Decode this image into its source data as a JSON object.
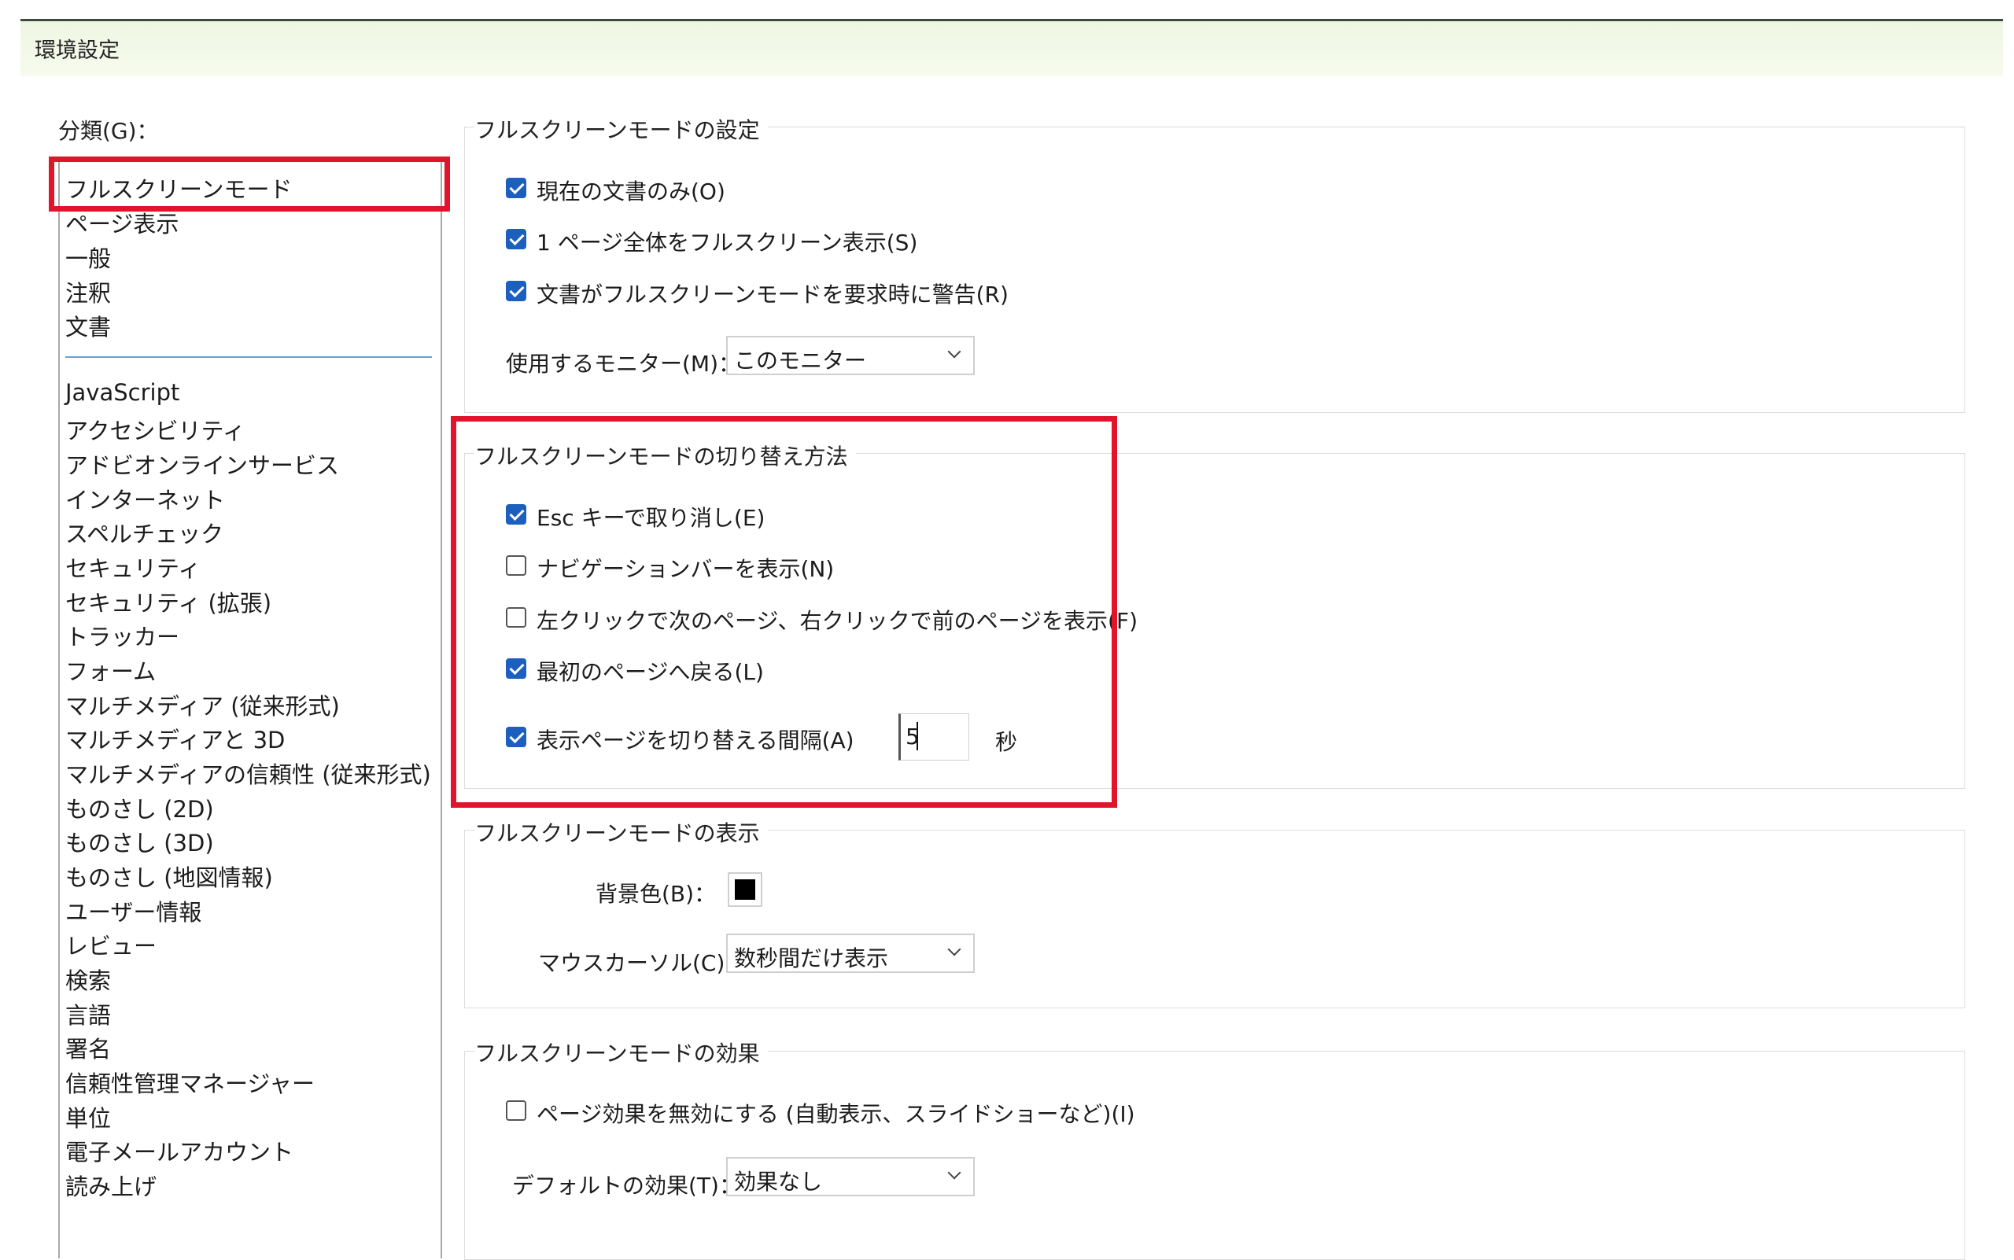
{
  "window": {
    "title": "環境設定"
  },
  "categories": {
    "label": "分類(G)：",
    "primary": [
      "フルスクリーンモード",
      "ページ表示",
      "一般",
      "注釈",
      "文書"
    ],
    "secondary": [
      "JavaScript",
      "アクセシビリティ",
      "アドビオンラインサービス",
      "インターネット",
      "スペルチェック",
      "セキュリティ",
      "セキュリティ (拡張)",
      "トラッカー",
      "フォーム",
      "マルチメディア (従来形式)",
      "マルチメディアと 3D",
      "マルチメディアの信頼性 (従来形式)",
      "ものさし (2D)",
      "ものさし (3D)",
      "ものさし (地図情報)",
      "ユーザー情報",
      "レビュー",
      "検索",
      "言語",
      "署名",
      "信頼性管理マネージャー",
      "単位",
      "電子メールアカウント",
      "読み上げ"
    ],
    "selected": "フルスクリーンモード"
  },
  "setup": {
    "title": "フルスクリーンモードの設定",
    "current_doc_only": {
      "label": "現在の文書のみ(O)",
      "checked": true
    },
    "fit_page": {
      "label": "1 ページ全体をフルスクリーン表示(S)",
      "checked": true
    },
    "warn": {
      "label": "文書がフルスクリーンモードを要求時に警告(R)",
      "checked": true
    },
    "monitor_label": "使用するモニター(M)：",
    "monitor_value": "このモニター"
  },
  "switching": {
    "title": "フルスクリーンモードの切り替え方法",
    "esc": {
      "label": "Esc キーで取り消し(E)",
      "checked": true
    },
    "navbar": {
      "label": "ナビゲーションバーを表示(N)",
      "checked": false
    },
    "click_nav": {
      "label": "左クリックで次のページ、右クリックで前のページを表示(F)",
      "checked": false
    },
    "loop": {
      "label": "最初のページへ戻る(L)",
      "checked": true
    },
    "advance": {
      "label": "表示ページを切り替える間隔(A)",
      "checked": true
    },
    "interval_value": "5",
    "interval_unit": "秒"
  },
  "appearance": {
    "title": "フルスクリーンモードの表示",
    "bg_label": "背景色(B)：",
    "bg_color": "#000000",
    "cursor_label": "マウスカーソル(C)：",
    "cursor_value": "数秒間だけ表示"
  },
  "effects": {
    "title": "フルスクリーンモードの効果",
    "ignore": {
      "label": "ページ効果を無効にする (自動表示、スライドショーなど)(I)",
      "checked": false
    },
    "default_label": "デフォルトの効果(T)：",
    "default_value": "効果なし"
  },
  "accent": {
    "checked": "#1d5fbf",
    "highlight": "#e0142a",
    "separator": "#6aa0cf"
  }
}
